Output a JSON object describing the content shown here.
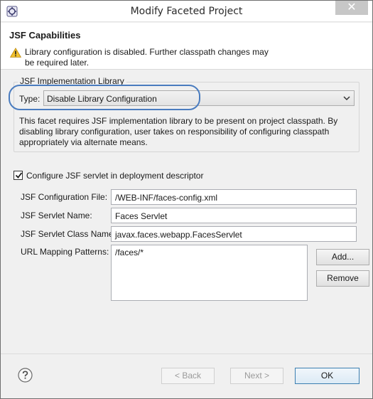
{
  "window": {
    "title": "Modify Faceted Project",
    "close_glyph": "✕"
  },
  "header": {
    "title": "JSF Capabilities",
    "message_line1": "Library configuration is disabled. Further classpath changes may",
    "message_line2": "be required later.",
    "icon": "warning-icon"
  },
  "implementation": {
    "group_title": "JSF Implementation Library",
    "type_label": "Type:",
    "type_value": "Disable Library Configuration",
    "description": "This facet requires JSF implementation library to be present on project classpath. By disabling library configuration, user takes on responsibility of configuring classpath appropriately via alternate means."
  },
  "servlet": {
    "configure_label": "Configure JSF servlet in deployment descriptor",
    "configure_checked": true,
    "config_file_label": "JSF Configuration File:",
    "config_file_value": "/WEB-INF/faces-config.xml",
    "servlet_name_label": "JSF Servlet Name:",
    "servlet_name_value": "Faces Servlet",
    "servlet_class_label": "JSF Servlet Class Name:",
    "servlet_class_value": "javax.faces.webapp.FacesServlet",
    "url_patterns_label": "URL Mapping Patterns:",
    "url_patterns": [
      "/faces/*"
    ],
    "add_label": "Add...",
    "remove_label": "Remove"
  },
  "footer": {
    "back_label": "< Back",
    "next_label": "Next >",
    "ok_label": "OK",
    "help_icon": "help-icon"
  },
  "colors": {
    "highlight": "#4a7cbf",
    "warning": "#f2c12e",
    "default_button_border": "#3c7fb1"
  }
}
